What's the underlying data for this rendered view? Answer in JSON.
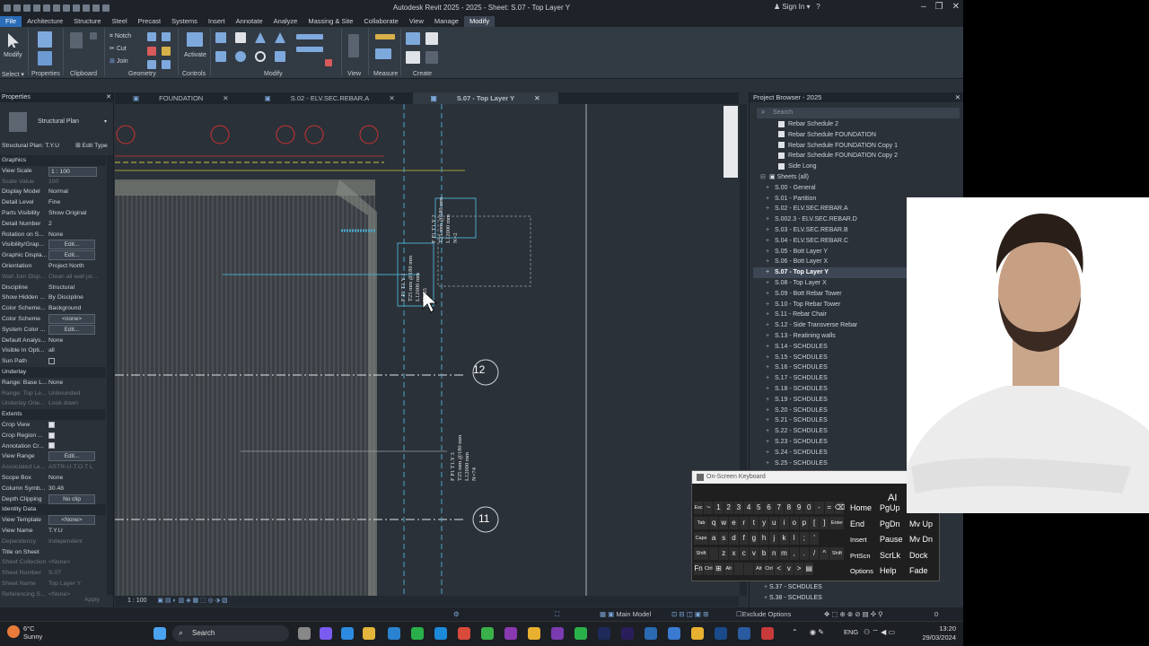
{
  "app": {
    "title": "Autodesk Revit 2025 - 2025 - Sheet: S.07 - Top Layer Y",
    "signin": "Sign In"
  },
  "ribbon_tabs": [
    "File",
    "Architecture",
    "Structure",
    "Steel",
    "Precast",
    "Systems",
    "Insert",
    "Annotate",
    "Analyze",
    "Massing & Site",
    "Collaborate",
    "View",
    "Manage",
    "Modify"
  ],
  "ribbon": {
    "modify": "Modify",
    "notch": "Notch",
    "cut": "Cut",
    "join": "Join",
    "activate": "Activate",
    "groups": [
      "Select",
      "Properties",
      "Clipboard",
      "Geometry",
      "Controls",
      "Modify",
      "View",
      "Measure",
      "Create"
    ]
  },
  "properties": {
    "header": "Properties",
    "type_name": "Structural Plan",
    "selector": "Structural Plan: T.Y.U",
    "edit_type": "Edit Type",
    "rows": [
      {
        "k": "Graphics",
        "v": "",
        "sec": true
      },
      {
        "k": "View Scale",
        "v": "1 : 100",
        "box": true
      },
      {
        "k": "Scale Value",
        "v": "100",
        "dim": true
      },
      {
        "k": "Display Model",
        "v": "Normal"
      },
      {
        "k": "Detail Level",
        "v": "Fine"
      },
      {
        "k": "Parts Visibility",
        "v": "Show Original"
      },
      {
        "k": "Detail Number",
        "v": "2"
      },
      {
        "k": "Rotation on S...",
        "v": "None"
      },
      {
        "k": "Visibility/Grap...",
        "v": "Edit...",
        "btn": true
      },
      {
        "k": "Graphic Displa...",
        "v": "Edit...",
        "btn": true
      },
      {
        "k": "Orientation",
        "v": "Project North"
      },
      {
        "k": "Wall Join Disp...",
        "v": "Clean all wall joi...",
        "dim": true
      },
      {
        "k": "Discipline",
        "v": "Structural"
      },
      {
        "k": "Show Hidden ...",
        "v": "By Discipline"
      },
      {
        "k": "Color Scheme...",
        "v": "Background"
      },
      {
        "k": "Color Scheme",
        "v": "<none>",
        "btn": true
      },
      {
        "k": "System Color ...",
        "v": "Edit...",
        "btn": true
      },
      {
        "k": "Default Analys...",
        "v": "None"
      },
      {
        "k": "Visible In Opti...",
        "v": "all"
      },
      {
        "k": "Sun Path",
        "v": "",
        "chk": "off"
      },
      {
        "k": "Underlay",
        "v": "",
        "sec": true
      },
      {
        "k": "Range: Base L...",
        "v": "None"
      },
      {
        "k": "Range: Top Le...",
        "v": "Unbounded",
        "dim": true
      },
      {
        "k": "Underlay Orie...",
        "v": "Look down",
        "dim": true
      },
      {
        "k": "Extents",
        "v": "",
        "sec": true
      },
      {
        "k": "Crop View",
        "v": "",
        "chk": "on"
      },
      {
        "k": "Crop Region ...",
        "v": "",
        "chk": "on"
      },
      {
        "k": "Annotation Cr...",
        "v": "",
        "chk": "on"
      },
      {
        "k": "View Range",
        "v": "Edit...",
        "btn": true
      },
      {
        "k": "Associated Le...",
        "v": "ASTR-U-T.O.T L",
        "dim": true
      },
      {
        "k": "Scope Box",
        "v": "None"
      },
      {
        "k": "Column Symb...",
        "v": "30.48"
      },
      {
        "k": "Depth Clipping",
        "v": "No clip",
        "btn": true
      },
      {
        "k": "Identity Data",
        "v": "",
        "sec": true
      },
      {
        "k": "View Template",
        "v": "<None>",
        "btn": true
      },
      {
        "k": "View Name",
        "v": "T.Y.U"
      },
      {
        "k": "Dependency",
        "v": "Independent",
        "dim": true
      },
      {
        "k": "Title on Sheet",
        "v": ""
      },
      {
        "k": "Sheet Collection",
        "v": "<None>",
        "dim": true
      },
      {
        "k": "Sheet Number",
        "v": "S.07",
        "dim": true
      },
      {
        "k": "Sheet Name",
        "v": "Top Layer Y",
        "dim": true
      },
      {
        "k": "Referencing S...",
        "v": "<None>",
        "dim": true
      }
    ],
    "apply": "Apply"
  },
  "view_tabs": [
    "FOUNDATION",
    "S.02 - ELV.SEC.REBAR.A",
    "S.07 - Top Layer Y"
  ],
  "canvas": {
    "grid_12": "12",
    "grid_11": "11",
    "tag1": [
      "F P1 T1.Y 2",
      "T25 mm @180 mm",
      "L12000 mm",
      "N=2"
    ],
    "tag2": [
      "F P1 T1.Y 1",
      "T25 mm @180 mm",
      "L12000 mm",
      "N=65"
    ],
    "tag3": [
      "F P1 T1.Y 3",
      "T25 mm @180 mm",
      "L12000 mm",
      "N=74"
    ],
    "scale": "1 : 100"
  },
  "project_browser": {
    "header": "Project Browser - 2025",
    "search_placeholder": "Search",
    "items": [
      {
        "t": "Rebar Schedule 2",
        "icon": "sched",
        "lvl": 2
      },
      {
        "t": "Rebar Schedule FOUNDATION",
        "icon": "sched",
        "lvl": 2
      },
      {
        "t": "Rebar Schedule FOUNDATION Copy 1",
        "icon": "sched",
        "lvl": 2
      },
      {
        "t": "Rebar Schedule FOUNDATION Copy 2",
        "icon": "sched",
        "lvl": 2
      },
      {
        "t": "Side Long",
        "icon": "sched",
        "lvl": 2
      },
      {
        "t": "Sheets (all)",
        "icon": "folder",
        "lvl": 0
      },
      {
        "t": "S.00 - General",
        "lvl": 1
      },
      {
        "t": "S.01 - Partition",
        "lvl": 1
      },
      {
        "t": "S.02 - ELV.SEC.REBAR.A",
        "lvl": 1
      },
      {
        "t": "S.002.3 - ELV.SEC.REBAR.D",
        "lvl": 1
      },
      {
        "t": "S.03 - ELV.SEC.REBAR.B",
        "lvl": 1
      },
      {
        "t": "S.04 - ELV.SEC.REBAR.C",
        "lvl": 1
      },
      {
        "t": "S.05 - Bott Layer Y",
        "lvl": 1
      },
      {
        "t": "S.06 - Bott Layer X",
        "lvl": 1
      },
      {
        "t": "S.07 - Top Layer Y",
        "lvl": 1,
        "sel": true
      },
      {
        "t": "S.08 - Top Layer X",
        "lvl": 1
      },
      {
        "t": "S.09 - Bott Rebar Tower",
        "lvl": 1
      },
      {
        "t": "S.10 - Top Rebar Tower",
        "lvl": 1
      },
      {
        "t": "S.11 - Rebar Chair",
        "lvl": 1
      },
      {
        "t": "S.12 - Side Transverse Rebar",
        "lvl": 1
      },
      {
        "t": "S.13 - Reatining walls",
        "lvl": 1
      },
      {
        "t": "S.14 - SCHDULES",
        "lvl": 1
      },
      {
        "t": "S.15 - SCHDULES",
        "lvl": 1
      },
      {
        "t": "S.16 - SCHDULES",
        "lvl": 1
      },
      {
        "t": "S.17 - SCHDULES",
        "lvl": 1
      },
      {
        "t": "S.18 - SCHDULES",
        "lvl": 1
      },
      {
        "t": "S.19 - SCHDULES",
        "lvl": 1
      },
      {
        "t": "S.20 - SCHDULES",
        "lvl": 1
      },
      {
        "t": "S.21 - SCHDULES",
        "lvl": 1
      },
      {
        "t": "S.22 - SCHDULES",
        "lvl": 1
      },
      {
        "t": "S.23 - SCHDULES",
        "lvl": 1
      },
      {
        "t": "S.24 - SCHDULES",
        "lvl": 1
      },
      {
        "t": "S.25 - SCHDULES",
        "lvl": 1
      }
    ],
    "bottom_items": [
      "S.37 - SCHDULES",
      "S.38 - SCHDULES"
    ]
  },
  "status": {
    "model": "Main Model",
    "exclude": "Exclude Options",
    "filter_count": "0"
  },
  "keyboard": {
    "title": "On-Screen Keyboard",
    "ai": "AI",
    "rows": [
      [
        "Esc",
        "~",
        "1",
        "2",
        "3",
        "4",
        "5",
        "6",
        "7",
        "8",
        "9",
        "0",
        "-",
        "=",
        "⌫"
      ],
      [
        "Tab",
        "q",
        "w",
        "e",
        "r",
        "t",
        "y",
        "u",
        "i",
        "o",
        "p",
        "[",
        "]",
        "Enter"
      ],
      [
        "Caps",
        "a",
        "s",
        "d",
        "f",
        "g",
        "h",
        "j",
        "k",
        "l",
        ";",
        "'"
      ],
      [
        "Shift",
        "",
        "z",
        "x",
        "c",
        "v",
        "b",
        "n",
        "m",
        ",",
        ".",
        "/",
        "^",
        "Shift"
      ],
      [
        "Fn",
        "Ctrl",
        "⊞",
        "Alt",
        "",
        "",
        "Alt",
        "Ctrl",
        "<",
        "v",
        ">",
        "▤"
      ]
    ],
    "right_keys": [
      [
        "Home",
        "PgUp",
        "Nav"
      ],
      [
        "End",
        "PgDn",
        "Mv Up"
      ],
      [
        "Insert",
        "Pause",
        "Mv Dn"
      ],
      [
        "PrtScn",
        "ScrLk",
        "Dock"
      ],
      [
        "Options",
        "Help",
        "Fade"
      ]
    ]
  },
  "taskbar": {
    "weather_temp": "6°C",
    "weather_desc": "Sunny",
    "search": "Search",
    "lang": "ENG",
    "time": "13:20",
    "date": "29/03/2024"
  }
}
